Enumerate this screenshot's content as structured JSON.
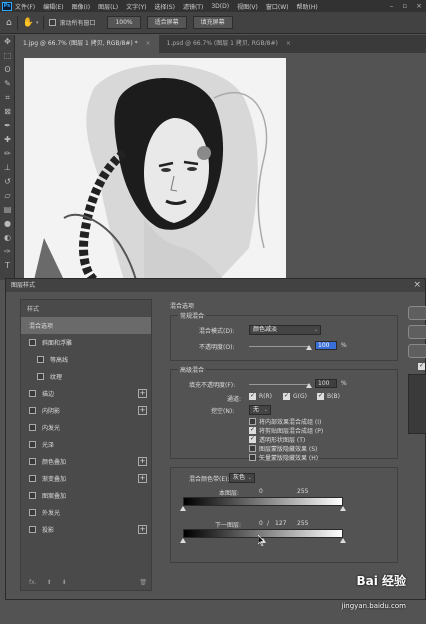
{
  "app": {
    "logo": "Ps",
    "menu": [
      "文件(F)",
      "编辑(E)",
      "图像(I)",
      "图层(L)",
      "文字(Y)",
      "选择(S)",
      "滤镜(T)",
      "3D(D)",
      "视图(V)",
      "窗口(W)",
      "帮助(H)"
    ]
  },
  "options": {
    "scroll_all_label": "滚动所有窗口",
    "zoom_btn": "100%",
    "fit_btn": "适合屏幕",
    "fill_btn": "填充屏幕"
  },
  "tabs": [
    {
      "label": "1.jpg @ 66.7% (图层 1 拷贝, RGB/8#) *",
      "close": "×"
    },
    {
      "label": "1.psd @ 66.7% (图层 1 拷贝, RGB/8#)",
      "close": "×"
    }
  ],
  "dialog": {
    "title": "图层样式",
    "style_list": [
      {
        "label": "样式",
        "type": "header"
      },
      {
        "label": "混合选项",
        "type": "selected"
      },
      {
        "label": "斜面和浮雕",
        "type": "check"
      },
      {
        "label": "等高线",
        "type": "sub"
      },
      {
        "label": "纹理",
        "type": "sub"
      },
      {
        "label": "描边",
        "type": "check",
        "plus": true
      },
      {
        "label": "内阴影",
        "type": "check",
        "plus": true
      },
      {
        "label": "内发光",
        "type": "check"
      },
      {
        "label": "光泽",
        "type": "check"
      },
      {
        "label": "颜色叠加",
        "type": "check",
        "plus": true
      },
      {
        "label": "渐变叠加",
        "type": "check",
        "plus": true
      },
      {
        "label": "图案叠加",
        "type": "check"
      },
      {
        "label": "外发光",
        "type": "check"
      },
      {
        "label": "投影",
        "type": "check",
        "plus": true
      }
    ],
    "footer": {
      "fx": "fx.",
      "up": "⬆",
      "down": "⬇",
      "trash": "🗑"
    },
    "blend_options": {
      "heading": "混合选项",
      "general": {
        "title": "常规混合",
        "mode_label": "混合模式(D):",
        "mode_value": "颜色减淡",
        "opacity_label": "不透明度(O):",
        "opacity_value": "100",
        "opacity_unit": "%",
        "opacity_level": 1.0
      },
      "advanced": {
        "title": "高级混合",
        "fill_label": "填充不透明度(F):",
        "fill_value": "100",
        "fill_unit": "%",
        "fill_level": 1.0,
        "channels_label": "通道:",
        "channels": [
          "R(R)",
          "G(G)",
          "B(B)"
        ],
        "knockout_label": "挖空(N):",
        "knockout_value": "无",
        "options": [
          {
            "label": "将内部效果混合成组 (I)",
            "checked": false
          },
          {
            "label": "将剪贴图层混合成组 (P)",
            "checked": true
          },
          {
            "label": "透明形状图层 (T)",
            "checked": true
          },
          {
            "label": "图层蒙版隐藏效果 (S)",
            "checked": false
          },
          {
            "label": "矢量蒙版隐藏效果 (H)",
            "checked": false
          }
        ]
      },
      "blend_if": {
        "label": "混合颜色带(E):",
        "value": "灰色",
        "this_layer_label": "本图层:",
        "this_layer_low": "0",
        "this_layer_high": "255",
        "underlying_label": "下一图层:",
        "underlying_low": "0",
        "underlying_sep": "/",
        "underlying_mid": "127",
        "underlying_high": "255"
      }
    }
  },
  "watermark": {
    "text": "Bai 经验",
    "url": "jingyan.baidu.com"
  }
}
